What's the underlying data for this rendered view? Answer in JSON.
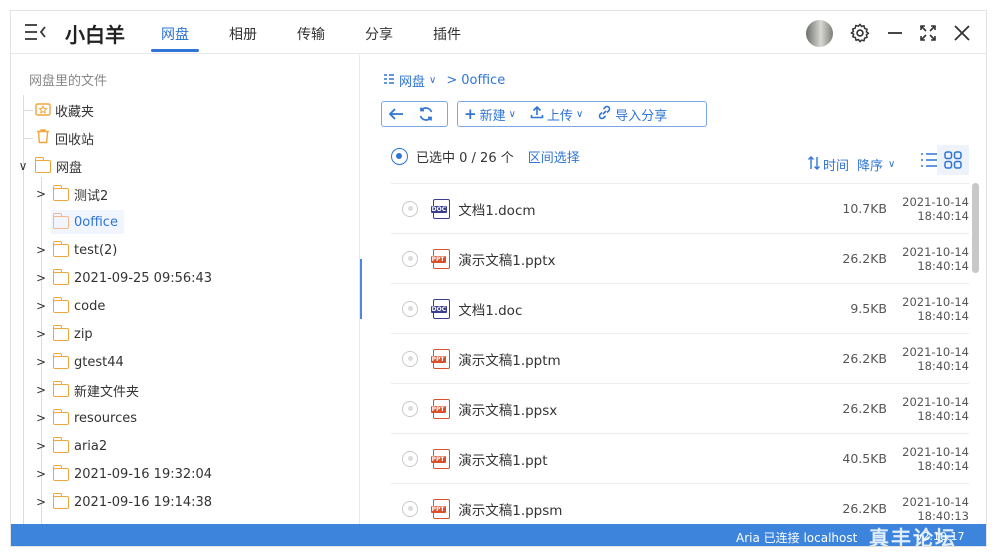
{
  "header": {
    "app_title": "小白羊",
    "tabs": [
      {
        "label": "网盘",
        "active": true
      },
      {
        "label": "相册"
      },
      {
        "label": "传输"
      },
      {
        "label": "分享"
      },
      {
        "label": "插件"
      }
    ],
    "icons": {
      "menu": "≡",
      "settings": "⚙",
      "minimize": "—",
      "maximize": "⤢",
      "close": "✕"
    }
  },
  "tree": {
    "header": "网盘里的文件",
    "items": [
      {
        "label": "收藏夹"
      },
      {
        "label": "回收站"
      },
      {
        "label": "网盘"
      },
      {
        "label": "测试2"
      },
      {
        "label": "0office"
      },
      {
        "label": "test(2)"
      },
      {
        "label": "2021-09-25 09:56:43"
      },
      {
        "label": "code"
      },
      {
        "label": "zip"
      },
      {
        "label": "gtest44"
      },
      {
        "label": "新建文件夹"
      },
      {
        "label": "resources"
      },
      {
        "label": "aria2"
      },
      {
        "label": "2021-09-16 19:32:04"
      },
      {
        "label": "2021-09-16 19:14:38"
      }
    ]
  },
  "breadcrumb": {
    "root": "网盘",
    "current": "0office"
  },
  "toolbar": {
    "new_label": "新建",
    "upload_label": "上传",
    "import_label": "导入分享"
  },
  "selection": {
    "text": "已选中 0 / 26 个",
    "range_select": "区间选择"
  },
  "sort": {
    "field": "时间",
    "order": "降序"
  },
  "files": [
    {
      "type": "doc",
      "badge": "DOC",
      "name": "文档1.docm",
      "size": "10.7KB",
      "date": "2021-10-14",
      "time": "18:40:14"
    },
    {
      "type": "ppt",
      "badge": "PPT",
      "name": "演示文稿1.pptx",
      "size": "26.2KB",
      "date": "2021-10-14",
      "time": "18:40:14"
    },
    {
      "type": "doc",
      "badge": "DOC",
      "name": "文档1.doc",
      "size": "9.5KB",
      "date": "2021-10-14",
      "time": "18:40:14"
    },
    {
      "type": "ppt",
      "badge": "PPT",
      "name": "演示文稿1.pptm",
      "size": "26.2KB",
      "date": "2021-10-14",
      "time": "18:40:14"
    },
    {
      "type": "ppt",
      "badge": "PPT",
      "name": "演示文稿1.ppsx",
      "size": "26.2KB",
      "date": "2021-10-14",
      "time": "18:40:14"
    },
    {
      "type": "ppt",
      "badge": "PPT",
      "name": "演示文稿1.ppt",
      "size": "40.5KB",
      "date": "2021-10-14",
      "time": "18:40:14"
    },
    {
      "type": "ppt",
      "badge": "PPT",
      "name": "演示文稿1.ppsm",
      "size": "26.2KB",
      "date": "2021-10-14",
      "time": "18:40:13"
    }
  ],
  "status": {
    "aria": "Aria 已连接 localhost",
    "version": "v2.10.17",
    "watermark": "真丰论坛"
  },
  "colors": {
    "accent": "#2f75d6",
    "statusbar": "#3c84dc",
    "folder": "#f0a63a",
    "doc": "#3a3d8f",
    "ppt": "#d9502b"
  }
}
